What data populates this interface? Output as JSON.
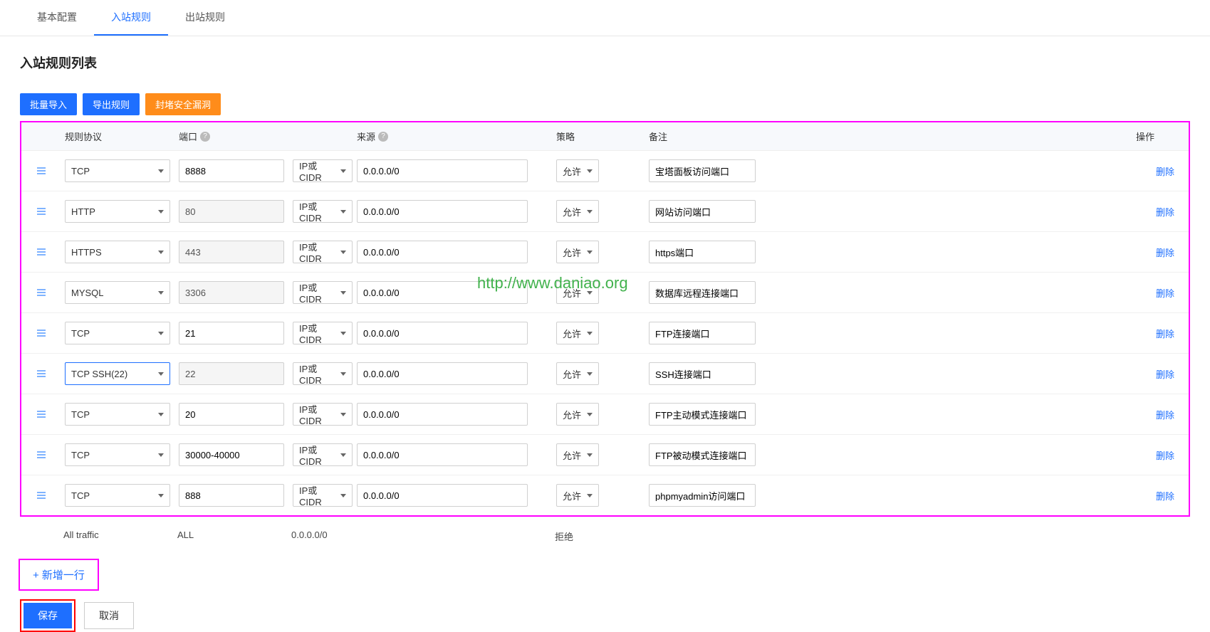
{
  "tabs": {
    "items": [
      "基本配置",
      "入站规则",
      "出站规则"
    ],
    "active": 1
  },
  "pageTitle": "入站规则列表",
  "actions": {
    "import": "批量导入",
    "export": "导出规则",
    "block": "封堵安全漏洞"
  },
  "headers": {
    "protocol": "规则协议",
    "port": "端口",
    "source": "来源",
    "policy": "策略",
    "remark": "备注",
    "op": "操作"
  },
  "sourceType": "IP或CIDR",
  "deleteLabel": "删除",
  "rows": [
    {
      "protocol": "TCP",
      "port": "8888",
      "portDisabled": false,
      "source": "0.0.0.0/0",
      "policy": "允许",
      "remark": "宝塔面板访问端口",
      "highlighted": false
    },
    {
      "protocol": "HTTP",
      "port": "80",
      "portDisabled": true,
      "source": "0.0.0.0/0",
      "policy": "允许",
      "remark": "网站访问端口",
      "highlighted": false
    },
    {
      "protocol": "HTTPS",
      "port": "443",
      "portDisabled": true,
      "source": "0.0.0.0/0",
      "policy": "允许",
      "remark": "https端口",
      "highlighted": false
    },
    {
      "protocol": "MYSQL",
      "port": "3306",
      "portDisabled": true,
      "source": "0.0.0.0/0",
      "policy": "允许",
      "remark": "数据库远程连接端口",
      "highlighted": false
    },
    {
      "protocol": "TCP",
      "port": "21",
      "portDisabled": false,
      "source": "0.0.0.0/0",
      "policy": "允许",
      "remark": "FTP连接端口",
      "highlighted": false
    },
    {
      "protocol": "TCP SSH(22)",
      "port": "22",
      "portDisabled": true,
      "source": "0.0.0.0/0",
      "policy": "允许",
      "remark": "SSH连接端口",
      "highlighted": true
    },
    {
      "protocol": "TCP",
      "port": "20",
      "portDisabled": false,
      "source": "0.0.0.0/0",
      "policy": "允许",
      "remark": "FTP主动模式连接端口",
      "highlighted": false
    },
    {
      "protocol": "TCP",
      "port": "30000-40000",
      "portDisabled": false,
      "source": "0.0.0.0/0",
      "policy": "允许",
      "remark": "FTP被动模式连接端口",
      "highlighted": false
    },
    {
      "protocol": "TCP",
      "port": "888",
      "portDisabled": false,
      "source": "0.0.0.0/0",
      "policy": "允许",
      "remark": "phpmyadmin访问端口",
      "highlighted": false
    }
  ],
  "staticRow": {
    "protocol": "All traffic",
    "port": "ALL",
    "source": "0.0.0.0/0",
    "policy": "拒绝"
  },
  "addRow": "+ 新增一行",
  "save": "保存",
  "cancel": "取消",
  "watermark": "http://www.daniao.org"
}
